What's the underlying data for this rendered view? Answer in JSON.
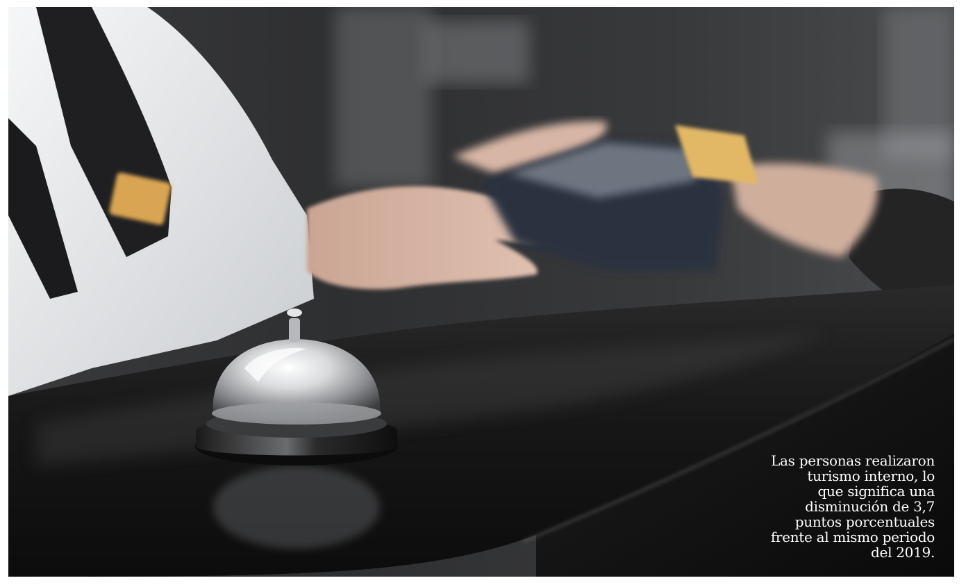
{
  "photo": {
    "subject": "hotel-reception-desk-with-service-bell",
    "colors": {
      "background": "#2c2c2e",
      "counter": "#141414",
      "shirt": "#eef0f2",
      "tie": "#1c1c1e",
      "skin": "#d7b5a4",
      "card": "#e2b866",
      "bell_metal": "#c9cbcd"
    }
  },
  "caption": {
    "lines": [
      "Las personas realizaron",
      "turismo interno, lo",
      "que significa una",
      "disminución de 3,7",
      "puntos porcentuales",
      "frente al mismo periodo",
      "del 2019."
    ]
  }
}
